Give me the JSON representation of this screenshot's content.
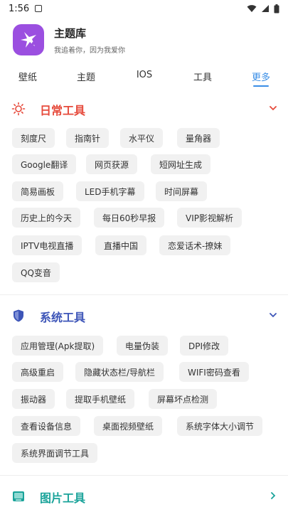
{
  "status": {
    "time": "1:56"
  },
  "app": {
    "title": "主题库",
    "subtitle": "我追着你，因为我爱你"
  },
  "tabs": [
    {
      "label": "壁纸"
    },
    {
      "label": "主题"
    },
    {
      "label": "IOS"
    },
    {
      "label": "工具"
    },
    {
      "label": "更多"
    }
  ],
  "daily": {
    "title": "日常工具",
    "color": "#e64a3b",
    "chips": [
      "刻度尺",
      "指南针",
      "水平仪",
      "量角器",
      "Google翻译",
      "网页获源",
      "短网址生成",
      "简易画板",
      "LED手机字幕",
      "时间屏幕",
      "历史上的今天",
      "每日60秒早报",
      "VIP影视解析",
      "IPTV电视直播",
      "直播中国",
      "恋爱话术-撩妹",
      "QQ变音"
    ]
  },
  "system": {
    "title": "系统工具",
    "color": "#3d55b8",
    "chips": [
      "应用管理(Apk提取)",
      "电量伪装",
      "DPI修改",
      "高级重启",
      "隐藏状态栏/导航栏",
      "WIFI密码查看",
      "振动器",
      "提取手机壁纸",
      "屏幕坏点检测",
      "查看设备信息",
      "桌面视频壁纸",
      "系统字体大小调节",
      "系统界面调节工具"
    ]
  },
  "image": {
    "title": "图片工具",
    "color": "#1aa39a"
  }
}
